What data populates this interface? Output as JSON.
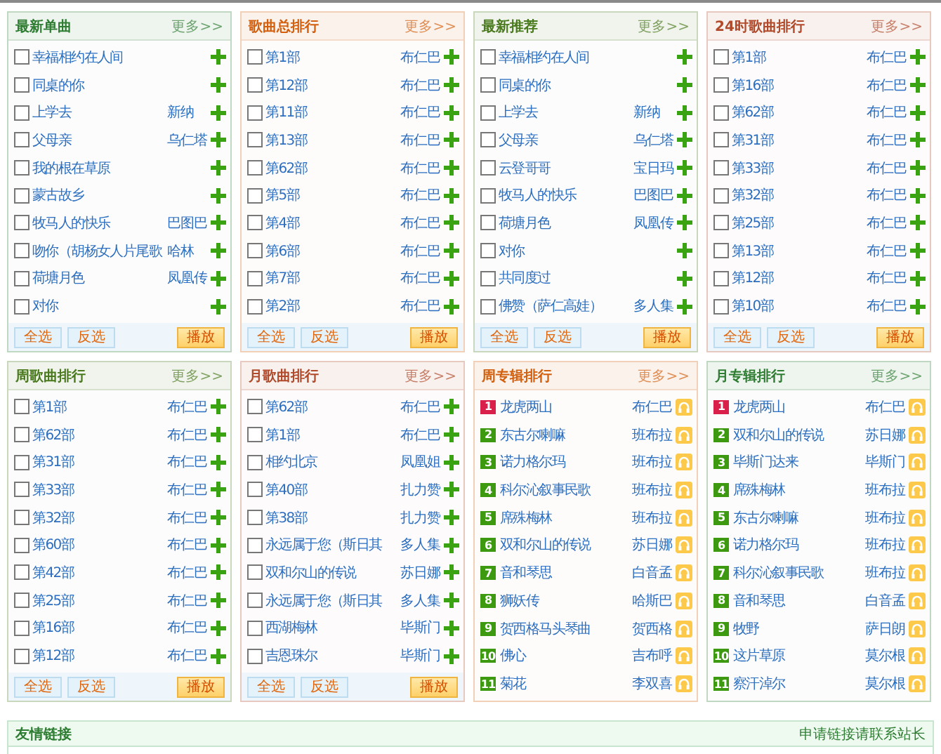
{
  "panels": [
    {
      "title": "最新单曲",
      "more": "更多>>",
      "color": "#2e7d32",
      "kind": "songs",
      "rows": [
        {
          "title": "幸福相约在人间",
          "checked": false
        },
        {
          "title": "同桌的你",
          "checked": false
        },
        {
          "title": "上学去",
          "artist": "新纳",
          "checked": false
        },
        {
          "title": "父母亲",
          "artist": "乌仁塔",
          "checked": false
        },
        {
          "title": "我的根在草原",
          "checked": false
        },
        {
          "title": "蒙古故乡",
          "checked": false
        },
        {
          "title": "牧马人的快乐",
          "artist": "巴图巴",
          "checked": false
        },
        {
          "title": "吻你（胡杨女人片尾歌",
          "artist": "哈林",
          "checked": false
        },
        {
          "title": "荷塘月色",
          "artist": "凤凰传",
          "checked": false
        },
        {
          "title": "对你",
          "checked": false
        }
      ],
      "buttons": [
        {
          "label": "全选",
          "kind": "plain"
        },
        {
          "label": "反选",
          "kind": "plain"
        },
        {
          "label": "播放",
          "kind": "play"
        }
      ]
    },
    {
      "title": "歌曲总排行",
      "more": "更多>>",
      "color": "#d2600e",
      "kind": "songs",
      "rows": [
        {
          "title": "第1部",
          "artist": "布仁巴",
          "checked": false
        },
        {
          "title": "第12部",
          "artist": "布仁巴",
          "checked": false
        },
        {
          "title": "第11部",
          "artist": "布仁巴",
          "checked": false
        },
        {
          "title": "第13部",
          "artist": "布仁巴",
          "checked": false
        },
        {
          "title": "第62部",
          "artist": "布仁巴",
          "checked": false
        },
        {
          "title": "第5部",
          "artist": "布仁巴",
          "checked": false
        },
        {
          "title": "第4部",
          "artist": "布仁巴",
          "checked": false
        },
        {
          "title": "第6部",
          "artist": "布仁巴",
          "checked": false
        },
        {
          "title": "第7部",
          "artist": "布仁巴",
          "checked": false
        },
        {
          "title": "第2部",
          "artist": "布仁巴",
          "checked": false
        }
      ],
      "buttons": [
        {
          "label": "全选",
          "kind": "plain"
        },
        {
          "label": "反选",
          "kind": "plain"
        },
        {
          "label": "播放",
          "kind": "play"
        }
      ]
    },
    {
      "title": "最新推荐",
      "more": "更多>>",
      "color": "#4a7a1e",
      "kind": "songs",
      "rows": [
        {
          "title": "幸福相约在人间",
          "checked": false
        },
        {
          "title": "同桌的你",
          "checked": false
        },
        {
          "title": "上学去",
          "artist": "新纳",
          "checked": false
        },
        {
          "title": "父母亲",
          "artist": "乌仁塔",
          "checked": false
        },
        {
          "title": "云登哥哥",
          "artist": "宝日玛",
          "checked": false
        },
        {
          "title": "牧马人的快乐",
          "artist": "巴图巴",
          "checked": false
        },
        {
          "title": "荷塘月色",
          "artist": "凤凰传",
          "checked": false
        },
        {
          "title": "对你",
          "checked": false
        },
        {
          "title": "共同度过",
          "checked": false
        },
        {
          "title": "佛赞（萨仁高娃）",
          "artist": "多人集",
          "checked": false
        }
      ],
      "buttons": [
        {
          "label": "全选",
          "kind": "plain"
        },
        {
          "label": "反选",
          "kind": "plain"
        },
        {
          "label": "播放",
          "kind": "play"
        }
      ]
    },
    {
      "title": "24时歌曲排行",
      "more": "更多>>",
      "color": "#b04a2a",
      "kind": "songs",
      "rows": [
        {
          "title": "第1部",
          "artist": "布仁巴",
          "checked": false
        },
        {
          "title": "第16部",
          "artist": "布仁巴",
          "checked": false
        },
        {
          "title": "第62部",
          "artist": "布仁巴",
          "checked": false
        },
        {
          "title": "第31部",
          "artist": "布仁巴",
          "checked": false
        },
        {
          "title": "第33部",
          "artist": "布仁巴",
          "checked": false
        },
        {
          "title": "第32部",
          "artist": "布仁巴",
          "checked": false
        },
        {
          "title": "第25部",
          "artist": "布仁巴",
          "checked": false
        },
        {
          "title": "第13部",
          "artist": "布仁巴",
          "checked": false
        },
        {
          "title": "第12部",
          "artist": "布仁巴",
          "checked": false
        },
        {
          "title": "第10部",
          "artist": "布仁巴",
          "checked": false
        }
      ],
      "buttons": [
        {
          "label": "全选",
          "kind": "plain"
        },
        {
          "label": "反选",
          "kind": "plain"
        },
        {
          "label": "播放",
          "kind": "play"
        }
      ]
    },
    {
      "title": "周歌曲排行",
      "more": "更多>>",
      "color": "#4a7a1e",
      "kind": "songs",
      "rows": [
        {
          "title": "第1部",
          "artist": "布仁巴",
          "checked": false
        },
        {
          "title": "第62部",
          "artist": "布仁巴",
          "checked": false
        },
        {
          "title": "第31部",
          "artist": "布仁巴",
          "checked": false
        },
        {
          "title": "第33部",
          "artist": "布仁巴",
          "checked": false
        },
        {
          "title": "第32部",
          "artist": "布仁巴",
          "checked": false
        },
        {
          "title": "第60部",
          "artist": "布仁巴",
          "checked": false
        },
        {
          "title": "第42部",
          "artist": "布仁巴",
          "checked": false
        },
        {
          "title": "第25部",
          "artist": "布仁巴",
          "checked": false
        },
        {
          "title": "第16部",
          "artist": "布仁巴",
          "checked": false
        },
        {
          "title": "第12部",
          "artist": "布仁巴",
          "checked": false
        }
      ],
      "buttons": [
        {
          "label": "全选",
          "kind": "plain"
        },
        {
          "label": "反选",
          "kind": "plain"
        },
        {
          "label": "播放",
          "kind": "play"
        }
      ]
    },
    {
      "title": "月歌曲排行",
      "more": "更多>>",
      "color": "#b04a2a",
      "kind": "songs",
      "rows": [
        {
          "title": "第62部",
          "artist": "布仁巴",
          "checked": false
        },
        {
          "title": "第1部",
          "artist": "布仁巴",
          "checked": false
        },
        {
          "title": "相约北京",
          "artist": "凤凰姐",
          "checked": false
        },
        {
          "title": "第40部",
          "artist": "扎力赞",
          "checked": false
        },
        {
          "title": "第38部",
          "artist": "扎力赞",
          "checked": false
        },
        {
          "title": "永远属于您（斯日其",
          "artist": "多人集",
          "checked": false
        },
        {
          "title": "双和尔山的传说",
          "artist": "苏日娜",
          "checked": false
        },
        {
          "title": "永远属于您（斯日其",
          "artist": "多人集",
          "checked": false
        },
        {
          "title": "西湖梅林",
          "artist": "毕斯门",
          "checked": false
        },
        {
          "title": "吉恩珠尔",
          "artist": "毕斯门",
          "checked": false
        }
      ],
      "buttons": [
        {
          "label": "全选",
          "kind": "plain"
        },
        {
          "label": "反选",
          "kind": "plain"
        },
        {
          "label": "播放",
          "kind": "play"
        }
      ]
    },
    {
      "title": "周专辑排行",
      "more": "更多>>",
      "color": "#d2600e",
      "kind": "albums",
      "rows": [
        {
          "rank": "1",
          "color": "#d8204a",
          "title": "龙虎两山",
          "artist": "布仁巴"
        },
        {
          "rank": "2",
          "color": "#3d9a10",
          "title": "东古尔喇嘛",
          "artist": "班布拉"
        },
        {
          "rank": "3",
          "color": "#3d9a10",
          "title": "诺力格尔玛",
          "artist": "班布拉"
        },
        {
          "rank": "4",
          "color": "#3d9a10",
          "title": "科尔沁叙事民歌",
          "artist": "班布拉"
        },
        {
          "rank": "5",
          "color": "#3d9a10",
          "title": "席殊梅林",
          "artist": "班布拉"
        },
        {
          "rank": "6",
          "color": "#3d9a10",
          "title": "双和尔山的传说",
          "artist": "苏日娜"
        },
        {
          "rank": "7",
          "color": "#3d9a10",
          "title": "音和琴思",
          "artist": "白音孟"
        },
        {
          "rank": "8",
          "color": "#3d9a10",
          "title": "狮妖传",
          "artist": "哈斯巴"
        },
        {
          "rank": "9",
          "color": "#3d9a10",
          "title": "贺西格马头琴曲",
          "artist": "贺西格"
        },
        {
          "rank": "10",
          "color": "#3d9a10",
          "title": "佛心",
          "artist": "吉布呼"
        },
        {
          "rank": "11",
          "color": "#3d9a10",
          "title": "菊花",
          "artist": "李双喜"
        }
      ]
    },
    {
      "title": "月专辑排行",
      "more": "更多>>",
      "color": "#2e7d32",
      "kind": "albums",
      "rows": [
        {
          "rank": "1",
          "color": "#d8204a",
          "title": "龙虎两山",
          "artist": "布仁巴"
        },
        {
          "rank": "2",
          "color": "#3d9a10",
          "title": "双和尔山的传说",
          "artist": "苏日娜"
        },
        {
          "rank": "3",
          "color": "#3d9a10",
          "title": "毕斯门达来",
          "artist": "毕斯门"
        },
        {
          "rank": "4",
          "color": "#3d9a10",
          "title": "席殊梅林",
          "artist": "班布拉"
        },
        {
          "rank": "5",
          "color": "#3d9a10",
          "title": "东古尔喇嘛",
          "artist": "班布拉"
        },
        {
          "rank": "6",
          "color": "#3d9a10",
          "title": "诺力格尔玛",
          "artist": "班布拉"
        },
        {
          "rank": "7",
          "color": "#3d9a10",
          "title": "科尔沁叙事民歌",
          "artist": "班布拉"
        },
        {
          "rank": "8",
          "color": "#3d9a10",
          "title": "音和琴思",
          "artist": "白音孟"
        },
        {
          "rank": "9",
          "color": "#3d9a10",
          "title": "牧野",
          "artist": "萨日朗"
        },
        {
          "rank": "10",
          "color": "#3d9a10",
          "title": "这片草原",
          "artist": "莫尔根"
        },
        {
          "rank": "11",
          "color": "#3d9a10",
          "title": "察汗淖尔",
          "artist": "莫尔根"
        }
      ]
    }
  ],
  "friend_links": {
    "title": "友情链接",
    "apply_link": "申请链接请联系站长"
  }
}
